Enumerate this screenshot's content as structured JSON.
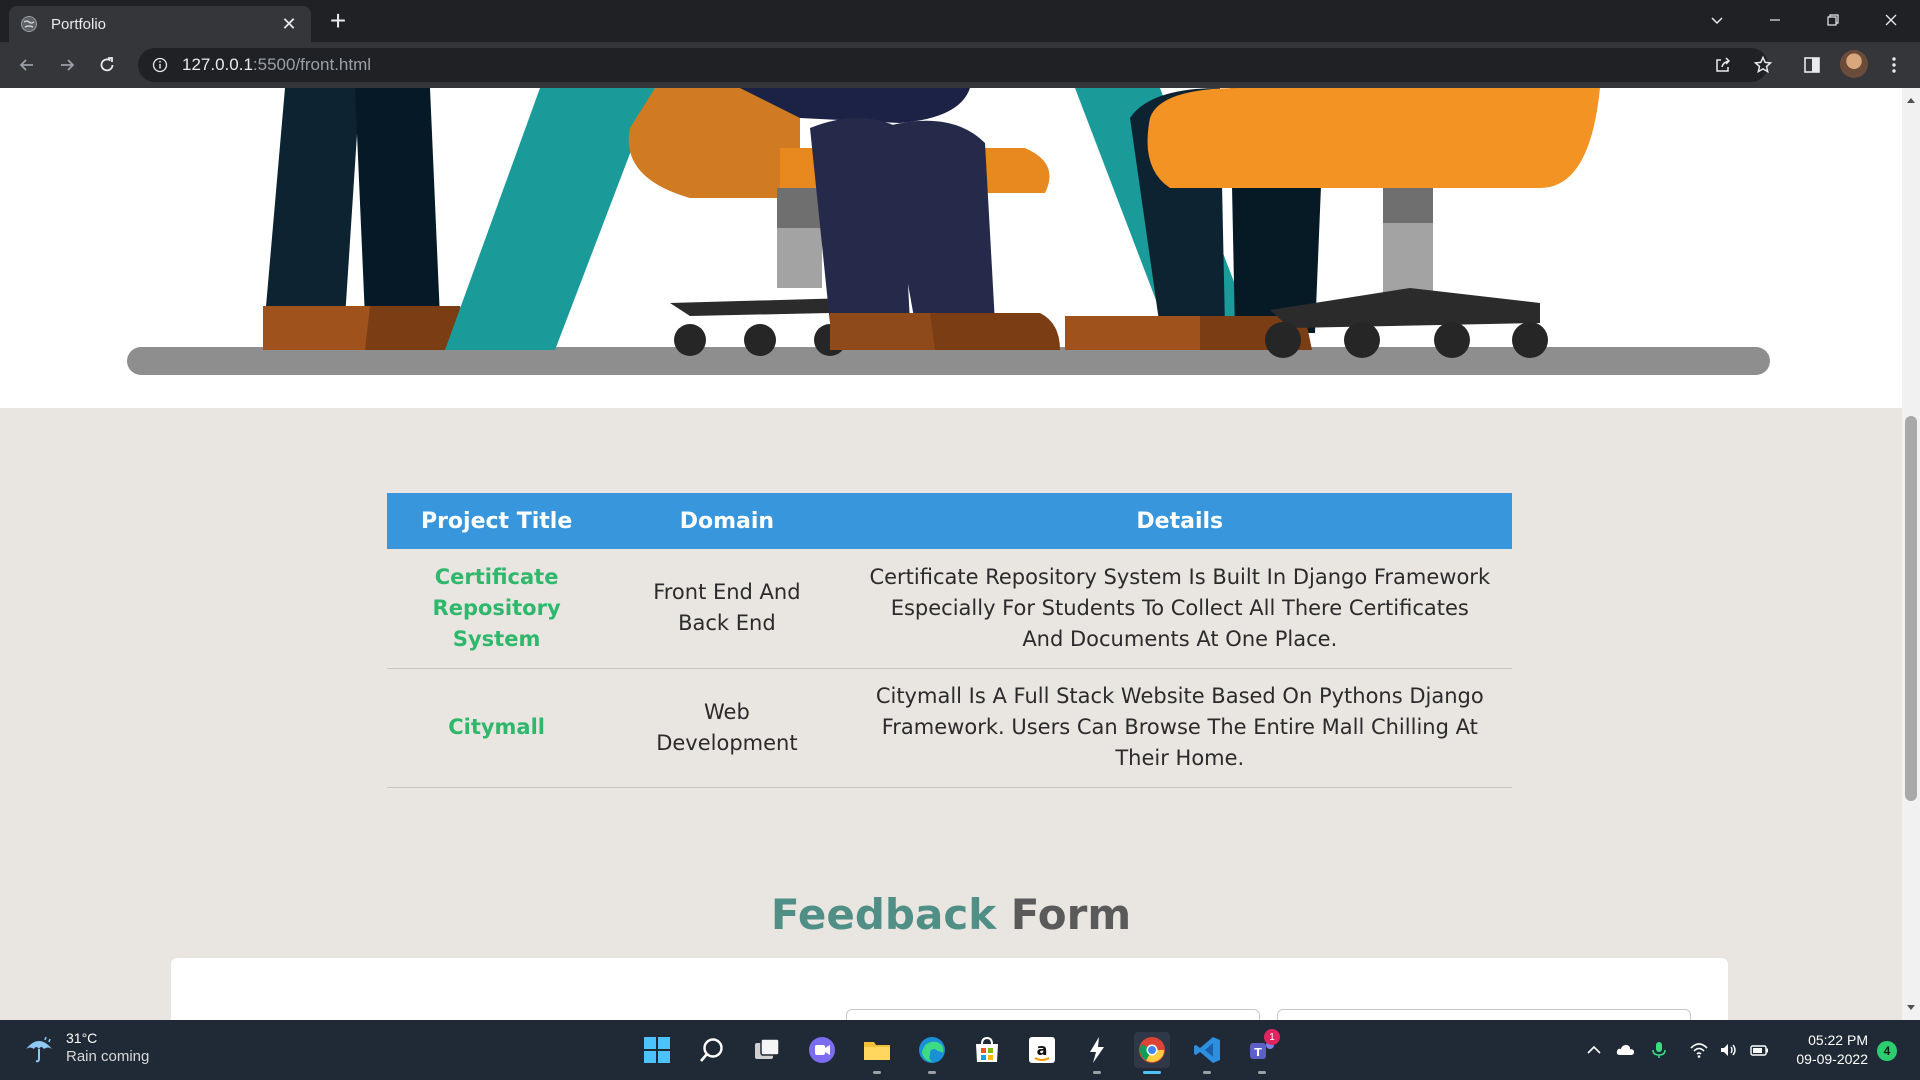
{
  "browser": {
    "tab_title": "Portfolio",
    "tab_close": "✕",
    "new_tab": "+",
    "url_host": "127.0.0.1",
    "url_rest": ":5500/front.html"
  },
  "projects": {
    "headers": [
      "Project Title",
      "Domain",
      "Details"
    ],
    "rows": [
      {
        "title": "Certificate Repository System",
        "domain": "Front End And Back End",
        "details": "Certificate Repository System Is Built In Django Framework Especially For Students To Collect All There Certificates And Documents At One Place."
      },
      {
        "title": "Citymall",
        "domain": "Web Development",
        "details": "Citymall Is A Full Stack Website Based On Pythons Django Framework. Users Can Browse The Entire Mall Chilling At Their Home."
      }
    ]
  },
  "feedback": {
    "heading_part1": "Feedback",
    "heading_part2": "Form"
  },
  "taskbar": {
    "weather_temp": "31°C",
    "weather_desc": "Rain coming",
    "time": "05:22 PM",
    "date": "09-09-2022",
    "notification_count": "4",
    "teams_badge": "1"
  },
  "colors": {
    "table_header": "#3796dc",
    "project_title": "#2eb86b",
    "feedback_accent": "#4f8f86",
    "page_background": "#e9e5e1"
  }
}
